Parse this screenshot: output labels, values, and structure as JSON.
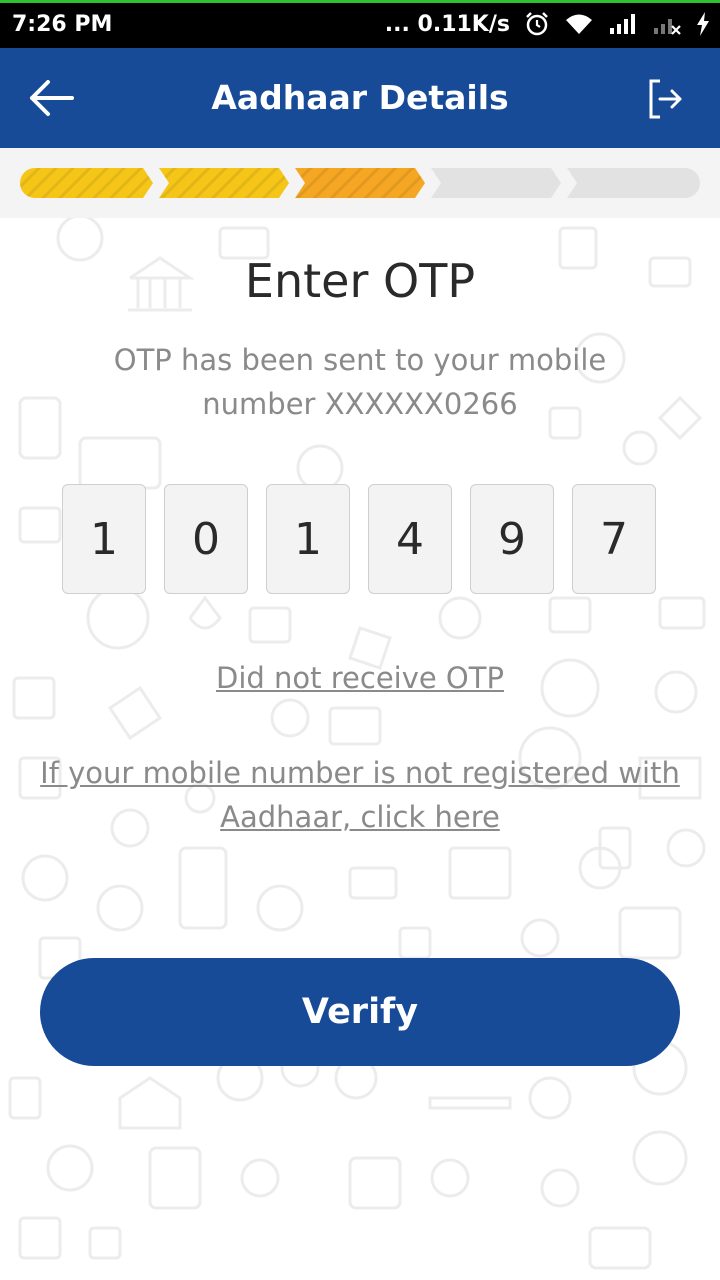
{
  "status_bar": {
    "time": "7:26 PM",
    "speed": "... 0.11K/s",
    "icons": [
      "alarm-icon",
      "wifi-icon",
      "signal-icon",
      "signal-no-sim-icon",
      "charging-icon"
    ]
  },
  "app_bar": {
    "title": "Aadhaar Details",
    "back_icon": "arrow-left-icon",
    "exit_icon": "logout-icon"
  },
  "progress": {
    "total_steps": 5,
    "completed_steps": 2,
    "current_step": 3,
    "colors": {
      "done": "#f5c518",
      "current": "#f5a623",
      "pending": "#e2e2e2"
    }
  },
  "otp": {
    "title": "Enter OTP",
    "subtitle_line1": "OTP has been sent to your mobile",
    "subtitle_line2": "number XXXXXX0266",
    "digits": [
      "1",
      "0",
      "1",
      "4",
      "9",
      "7"
    ]
  },
  "links": {
    "resend": "Did not receive OTP",
    "not_registered_line1": "If your mobile number is not registered with",
    "not_registered_line2": "Aadhaar, click here"
  },
  "actions": {
    "verify_label": "Verify"
  },
  "colors": {
    "brand": "#174a97",
    "status_accent": "#2fc12f"
  }
}
